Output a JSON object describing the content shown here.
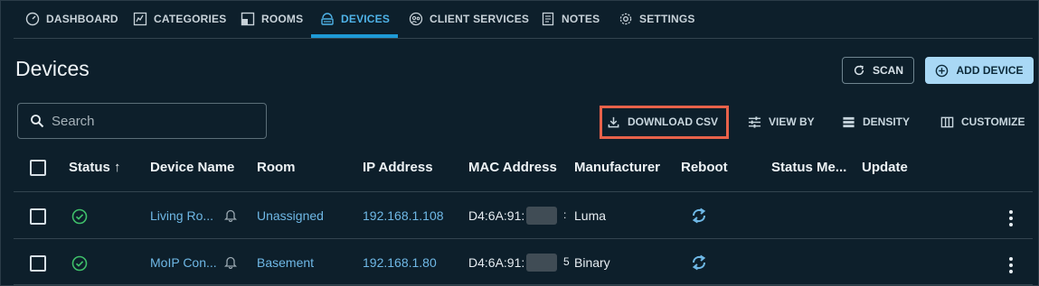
{
  "nav": {
    "items": [
      {
        "label": "DASHBOARD",
        "icon": "speedometer-icon"
      },
      {
        "label": "CATEGORIES",
        "icon": "chart-icon"
      },
      {
        "label": "ROOMS",
        "icon": "room-icon"
      },
      {
        "label": "DEVICES",
        "icon": "router-icon",
        "active": true
      },
      {
        "label": "CLIENT SERVICES",
        "icon": "people-icon"
      },
      {
        "label": "NOTES",
        "icon": "notes-icon"
      },
      {
        "label": "SETTINGS",
        "icon": "gear-icon"
      }
    ]
  },
  "page": {
    "title": "Devices"
  },
  "actions": {
    "scan": "SCAN",
    "add_device": "ADD DEVICE"
  },
  "search": {
    "placeholder": "Search",
    "value": ""
  },
  "toolbar": {
    "download_csv": "DOWNLOAD CSV",
    "view_by": "VIEW BY",
    "density": "DENSITY",
    "customize": "CUSTOMIZE"
  },
  "table": {
    "columns": [
      "Status",
      "Device Name",
      "Room",
      "IP Address",
      "MAC Address",
      "Manufacturer",
      "Reboot",
      "Status Me...",
      "Update"
    ],
    "sort_indicator": "↑",
    "rows": [
      {
        "status": "online",
        "device_name": "Living Ro...",
        "room": "Unassigned",
        "ip": "192.168.1.108",
        "mac": "D4:6A:91:",
        "mac_tail": ":",
        "manufacturer": "Luma"
      },
      {
        "status": "online",
        "device_name": "MoIP Con...",
        "room": "Basement",
        "ip": "192.168.1.80",
        "mac": "D4:6A:91:",
        "mac_tail": "5",
        "manufacturer": "Binary"
      }
    ]
  },
  "colors": {
    "background": "#0d1f2b",
    "accent": "#1e9ad6",
    "link": "#6fb8e6",
    "status_ok": "#3fbf6a",
    "highlight": "#e8624a"
  }
}
